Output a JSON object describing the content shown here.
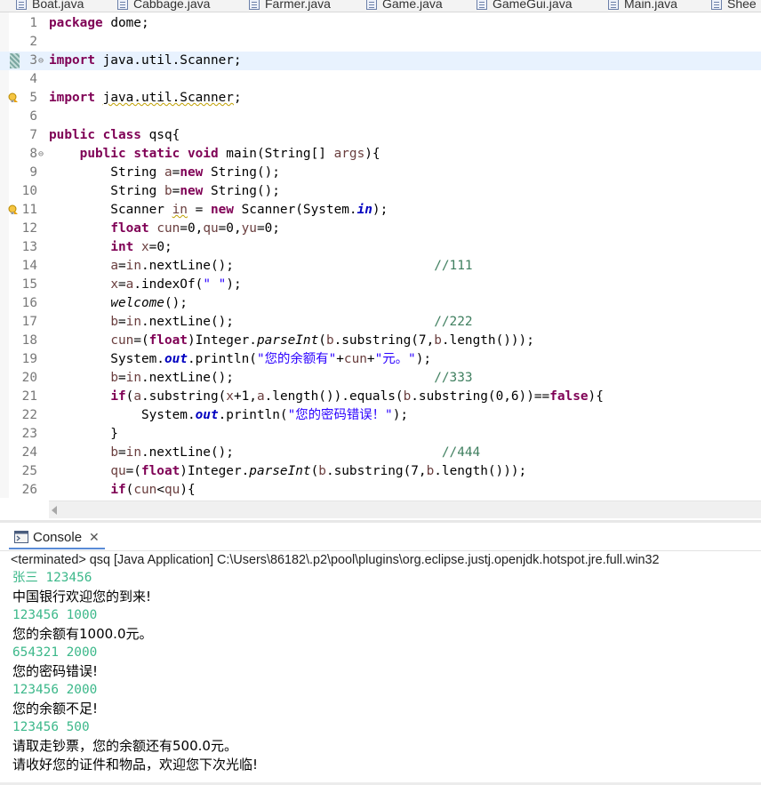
{
  "editor_tabs": [
    "Boat.java",
    "Cabbage.java",
    "Farmer.java",
    "Game.java",
    "GameGui.java",
    "Main.java",
    "Shee"
  ],
  "code_lines": [
    {
      "n": "1",
      "html": "<span class=\"kw\">package</span> dome;"
    },
    {
      "n": "2",
      "html": ""
    },
    {
      "n": "3",
      "fold": "⊖",
      "html": "<span class=\"kw\">import</span> java.util.Scanner;"
    },
    {
      "n": "4",
      "html": ""
    },
    {
      "n": "5",
      "html": "<span class=\"kw\">import</span> <span class=\"warn-ul\">java.util.Scanner</span>;"
    },
    {
      "n": "6",
      "html": ""
    },
    {
      "n": "7",
      "html": "<span class=\"kw\">public</span> <span class=\"kw\">class</span> qsq{"
    },
    {
      "n": "8",
      "fold": "⊖",
      "html": "    <span class=\"kw\">public</span> <span class=\"kw\">static</span> <span class=\"kw\">void</span> main(String[] <span class=\"var\">args</span>){"
    },
    {
      "n": "9",
      "html": "        String <span class=\"var\">a</span>=<span class=\"kw\">new</span> String();"
    },
    {
      "n": "10",
      "html": "        String <span class=\"var\">b</span>=<span class=\"kw\">new</span> String();"
    },
    {
      "n": "11",
      "html": "        Scanner <span class=\"var warn-ul\">in</span> = <span class=\"kw\">new</span> Scanner(System.<span class=\"fld\">in</span>);"
    },
    {
      "n": "12",
      "html": "        <span class=\"kw\">float</span> <span class=\"var\">cun</span>=0,<span class=\"var\">qu</span>=0,<span class=\"var\">yu</span>=0;"
    },
    {
      "n": "13",
      "html": "        <span class=\"kw\">int</span> <span class=\"var\">x</span>=0;"
    },
    {
      "n": "14",
      "html": "        <span class=\"var\">a</span>=<span class=\"var\">in</span>.nextLine();                          <span class=\"cmt\">//111</span>"
    },
    {
      "n": "15",
      "html": "        <span class=\"var\">x</span>=<span class=\"var\">a</span>.indexOf(<span class=\"str\">\" \"</span>);"
    },
    {
      "n": "16",
      "html": "        <span class=\"ital\">welcome</span>();"
    },
    {
      "n": "17",
      "html": "        <span class=\"var\">b</span>=<span class=\"var\">in</span>.nextLine();                          <span class=\"cmt\">//222</span>"
    },
    {
      "n": "18",
      "html": "        <span class=\"var\">cun</span>=(<span class=\"kw\">float</span>)Integer.<span class=\"ital\">parseInt</span>(<span class=\"var\">b</span>.substring(7,<span class=\"var\">b</span>.length()));"
    },
    {
      "n": "19",
      "html": "        System.<span class=\"fld\">out</span>.println(<span class=\"str\">\"您的余额有\"</span>+<span class=\"var\">cun</span>+<span class=\"str\">\"元。\"</span>);"
    },
    {
      "n": "20",
      "html": "        <span class=\"var\">b</span>=<span class=\"var\">in</span>.nextLine();                          <span class=\"cmt\">//333</span>"
    },
    {
      "n": "21",
      "html": "        <span class=\"kw\">if</span>(<span class=\"var\">a</span>.substring(<span class=\"var\">x</span>+1,<span class=\"var\">a</span>.length()).equals(<span class=\"var\">b</span>.substring(0,6))==<span class=\"kw\">false</span>){"
    },
    {
      "n": "22",
      "html": "            System.<span class=\"fld\">out</span>.println(<span class=\"str\">\"您的密码错误！\"</span>);"
    },
    {
      "n": "23",
      "html": "        }"
    },
    {
      "n": "24",
      "html": "        <span class=\"var\">b</span>=<span class=\"var\">in</span>.nextLine();                           <span class=\"cmt\">//444</span>"
    },
    {
      "n": "25",
      "html": "        <span class=\"var\">qu</span>=(<span class=\"kw\">float</span>)Integer.<span class=\"ital\">parseInt</span>(<span class=\"var\">b</span>.substring(7,<span class=\"var\">b</span>.length()));"
    },
    {
      "n": "26",
      "html": "        <span class=\"kw\">if</span>(<span class=\"var\">cun</span>&lt;<span class=\"var\">qu</span>){"
    }
  ],
  "console": {
    "tab_label": "Console",
    "close_glyph": "✕",
    "status": "<terminated> qsq [Java Application] C:\\Users\\86182\\.p2\\pool\\plugins\\org.eclipse.justj.openjdk.hotspot.jre.full.win32",
    "output": [
      {
        "text": "张三 123456",
        "kind": "in"
      },
      {
        "text": "中国银行欢迎您的到来!",
        "kind": "sys"
      },
      {
        "text": "123456 1000",
        "kind": "in"
      },
      {
        "text": "您的余额有1000.0元。",
        "kind": "sys"
      },
      {
        "text": "654321 2000",
        "kind": "in"
      },
      {
        "text": "您的密码错误!",
        "kind": "sys"
      },
      {
        "text": "123456 2000",
        "kind": "in"
      },
      {
        "text": "您的余额不足!",
        "kind": "sys"
      },
      {
        "text": "123456 500",
        "kind": "in"
      },
      {
        "text": "请取走钞票，您的余额还有500.0元。",
        "kind": "sys"
      },
      {
        "text": "请收好您的证件和物品，欢迎您下次光临!",
        "kind": "sys"
      }
    ]
  },
  "colors": {
    "keyword": "#7f0055",
    "string": "#2a00ff",
    "comment": "#3f7f5f",
    "console_input": "#3cb88a",
    "current_line": "#e8f2fe"
  }
}
